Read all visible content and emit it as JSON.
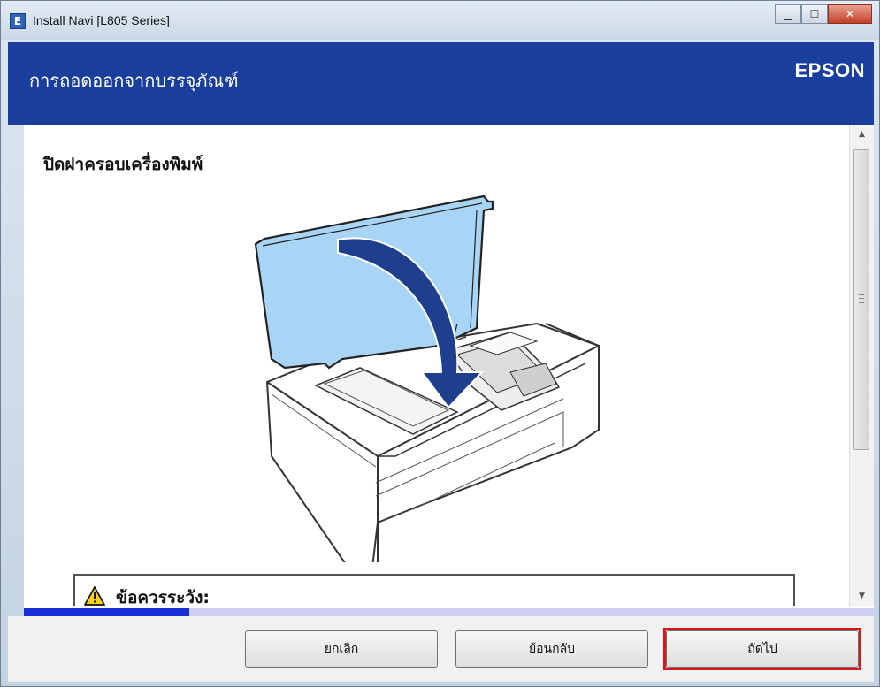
{
  "window": {
    "title": "Install Navi [L805 Series]",
    "icon_letter": "E",
    "controls": {
      "minimize": "minimize-icon",
      "maximize": "maximize-icon",
      "close": "close-icon"
    }
  },
  "header": {
    "title": "การถอดออกจากบรรจุภัณฑ์",
    "brand": "EPSON"
  },
  "content": {
    "heading": "ปิดฝาครอบเครื่องพิมพ์",
    "illustration_icon": "printer-close-cover-illustration",
    "caution": {
      "icon": "warning-icon",
      "label": "ข้อควรระวัง:"
    }
  },
  "progress": {
    "fraction": 0.195,
    "fill_color": "#1b2fd6",
    "track_color": "#cfcff2"
  },
  "footer": {
    "cancel_label": "ยกเลิก",
    "back_label": "ย้อนกลับ",
    "next_label": "ถัดไป"
  },
  "colors": {
    "header_bg": "#1a3e9c",
    "highlight": "#d21a1a"
  }
}
